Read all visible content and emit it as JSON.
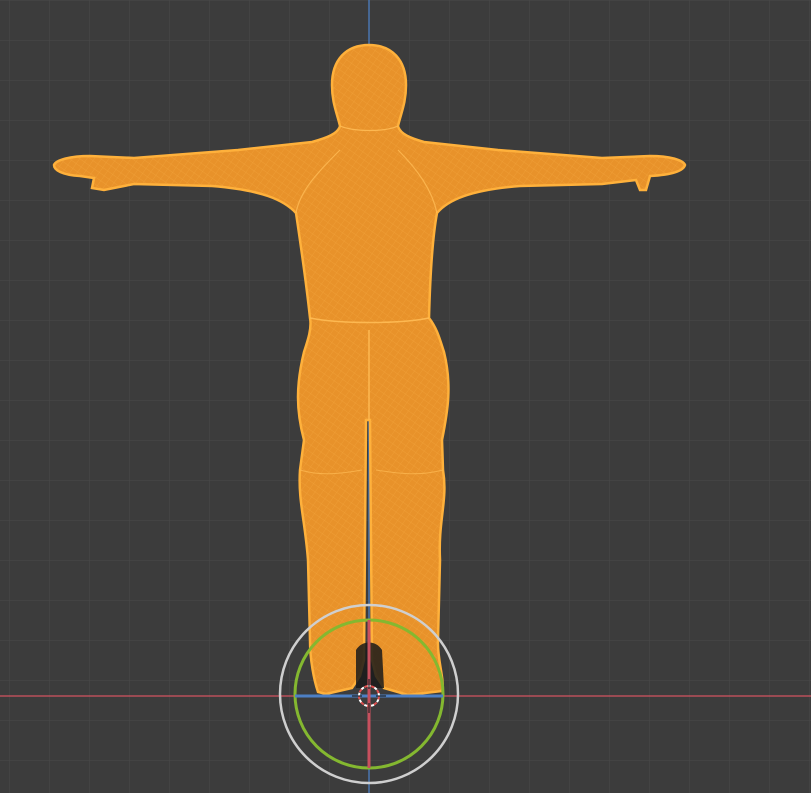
{
  "viewport": {
    "name": "3D Viewport",
    "view": "front-orthographic",
    "shading": "wireframe",
    "background_color": "#3c3c3c",
    "grid_color": "#4a4a4a",
    "x_axis_color": "#c8505e",
    "z_axis_color": "#4d7fc4"
  },
  "selected_object": {
    "kind": "human-mesh",
    "pose": "t-pose",
    "selected": true,
    "wire_color": "#f5a02a",
    "fill_color": "#e8922a"
  },
  "gizmo": {
    "kind": "transform-rotate",
    "outer_ring_color": "#cfcfcf",
    "inner_ring_color": "#84b830",
    "x_handle_color": "#4d7fc4",
    "z_handle_color": "#c8505e"
  },
  "cursor_3d": {
    "icon": "3d-cursor-icon"
  }
}
